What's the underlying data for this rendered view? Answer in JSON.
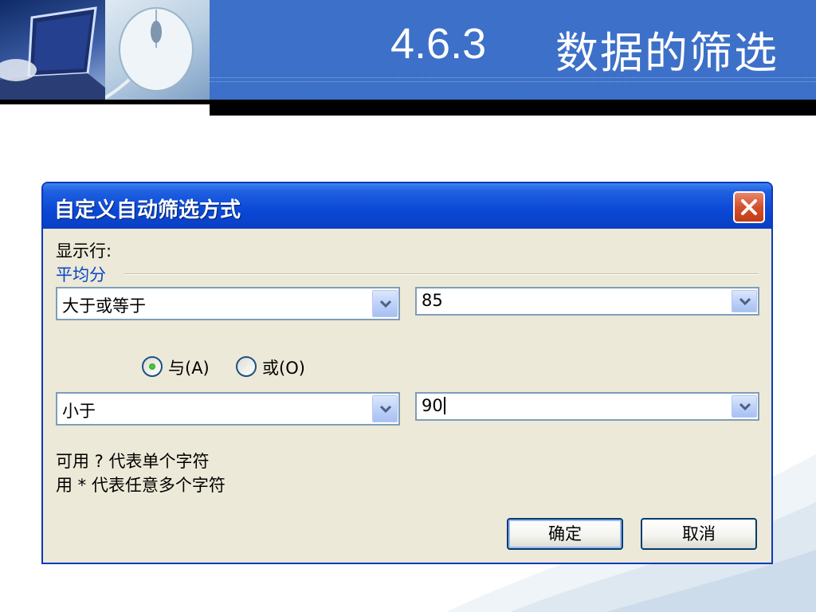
{
  "slide": {
    "number": "4.6.3",
    "title": "数据的筛选"
  },
  "dialog": {
    "title": "自定义自动筛选方式",
    "show_rows_label": "显示行:",
    "field_name": "平均分",
    "condition1": {
      "operator": "大于或等于",
      "value": "85"
    },
    "logic": {
      "and_label": "与(A)",
      "or_label": "或(O)",
      "selected": "and"
    },
    "condition2": {
      "operator": "小于",
      "value": "90"
    },
    "hint_line1": "可用 ? 代表单个字符",
    "hint_line2": "用 * 代表任意多个字符",
    "ok_label": "确定",
    "cancel_label": "取消"
  },
  "colors": {
    "title_band": "#3d70c8",
    "dialog_titlebar": "#0a48d6",
    "dialog_face": "#ece9d8",
    "group_label": "#0a46c8"
  }
}
